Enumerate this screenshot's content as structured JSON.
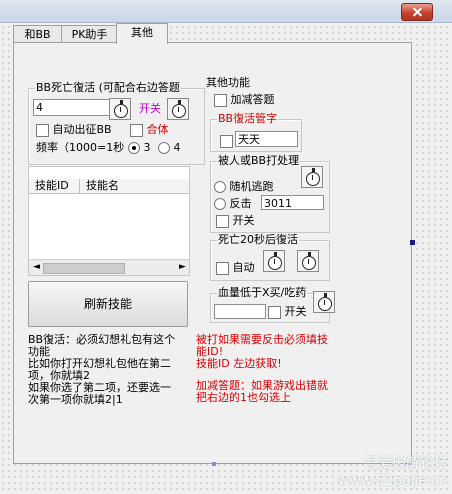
{
  "tabs": [
    "和BB",
    "PK助手",
    "其他"
  ],
  "bb_revive": {
    "title": "BB死亡復活 (可配合右边答题",
    "value": "4",
    "switch_label": "开关",
    "auto_summon_label": "自动出征BB",
    "combine_label": "合体",
    "freq_label": "频率（1000=1秒",
    "freq_options": [
      "3",
      "4"
    ]
  },
  "skill_table": {
    "columns": [
      "技能ID",
      "技能名"
    ]
  },
  "refresh_button": "刷新技能",
  "help_text": {
    "line1": "BB復活：必须幻想礼包有这个",
    "line2": "功能",
    "line3": "比如你打开幻想礼包他在第二",
    "line4": "项，你就填2",
    "line5": "如果你选了第二项，还要选一",
    "line6": "次第一项你就填2|1"
  },
  "other": {
    "title": "其他功能",
    "add_reduce_q": "加减答题",
    "bb_revive_admin_title": "BB復活管字",
    "admin_value": "天天",
    "attacked_title": "被人或BB打处理",
    "random_escape": "随机逃跑",
    "counter_label": "反击",
    "counter_value": "3011",
    "switch": "开关",
    "death_title": "死亡20秒后復活",
    "auto_label": "自动",
    "hp_title": "血量低于X买/吃药",
    "hp_switch": "开关"
  },
  "red_notes": {
    "n1": "被打如果需要反击必须填技",
    "n2": "能ID!",
    "n3": "技能ID 左边获取!",
    "n4": "加减答题：如果游戏出错就",
    "n5": "把右边的1也勾选上"
  },
  "watermark": {
    "line1": "吾爱破解论坛",
    "line2": "www.52pojie.cn"
  }
}
